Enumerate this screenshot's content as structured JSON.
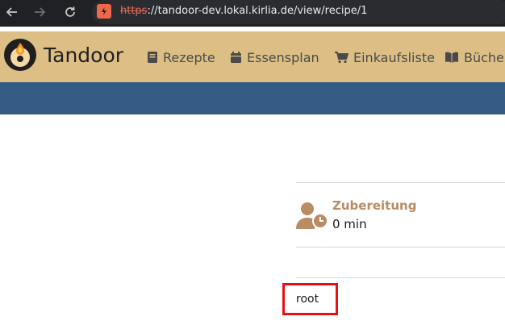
{
  "browser": {
    "url_scheme": "https",
    "url_rest": "://tandoor-dev.lokal.kirlia.de/view/recipe/1",
    "icons": [
      "back-icon",
      "forward-icon",
      "reload-icon",
      "insecure-site-icon"
    ]
  },
  "app": {
    "brand": "Tandoor",
    "nav": [
      {
        "label": "Rezepte",
        "icon": "book-icon"
      },
      {
        "label": "Essensplan",
        "icon": "calendar-icon"
      },
      {
        "label": "Einkaufsliste",
        "icon": "cart-icon"
      },
      {
        "label": "Büche",
        "icon": "open-book-icon"
      }
    ]
  },
  "recipe": {
    "preparation_label": "Zubereitung",
    "preparation_value": "0 min",
    "author": "root"
  },
  "colors": {
    "navbar": "#ddbf86",
    "subnav": "#355c85",
    "accent": "#b98c63",
    "highlight": "#e81010"
  }
}
